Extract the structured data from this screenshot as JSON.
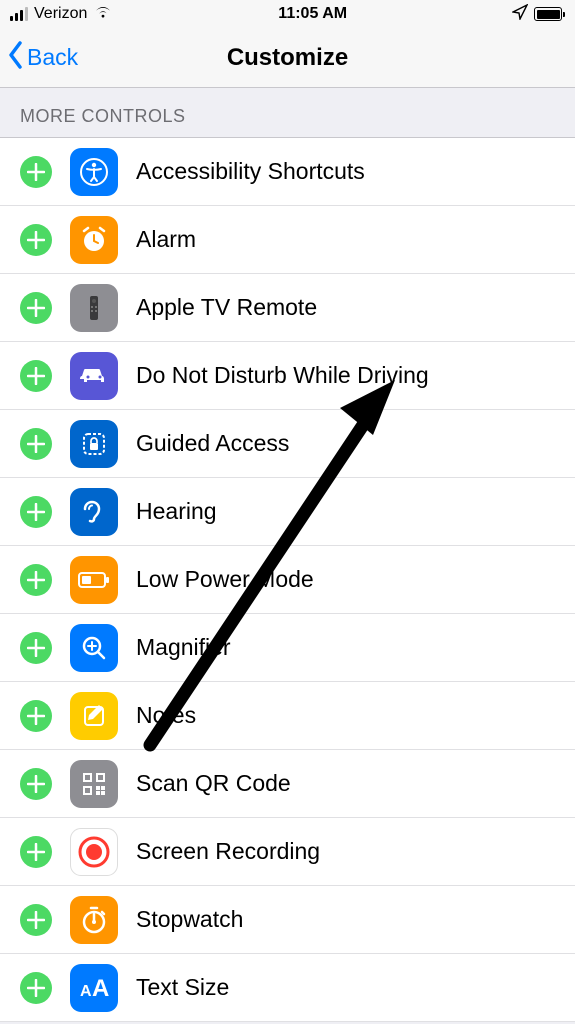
{
  "status": {
    "carrier": "Verizon",
    "time": "11:05 AM"
  },
  "nav": {
    "back_label": "Back",
    "title": "Customize"
  },
  "section": {
    "header": "MORE CONTROLS"
  },
  "controls": [
    {
      "id": "accessibility-shortcuts",
      "label": "Accessibility Shortcuts",
      "icon": "accessibility-icon",
      "color": "ic-blue"
    },
    {
      "id": "alarm",
      "label": "Alarm",
      "icon": "alarm-icon",
      "color": "ic-orange"
    },
    {
      "id": "apple-tv-remote",
      "label": "Apple TV Remote",
      "icon": "remote-icon",
      "color": "ic-gray"
    },
    {
      "id": "dnd-driving",
      "label": "Do Not Disturb While Driving",
      "icon": "car-icon",
      "color": "ic-purple"
    },
    {
      "id": "guided-access",
      "label": "Guided Access",
      "icon": "lock-dashed-icon",
      "color": "ic-darkblue"
    },
    {
      "id": "hearing",
      "label": "Hearing",
      "icon": "ear-icon",
      "color": "ic-darkblue"
    },
    {
      "id": "low-power-mode",
      "label": "Low Power Mode",
      "icon": "battery-icon",
      "color": "ic-orange"
    },
    {
      "id": "magnifier",
      "label": "Magnifier",
      "icon": "magnifier-icon",
      "color": "ic-blue"
    },
    {
      "id": "notes",
      "label": "Notes",
      "icon": "notes-icon",
      "color": "ic-yellow"
    },
    {
      "id": "scan-qr",
      "label": "Scan QR Code",
      "icon": "qr-icon",
      "color": "ic-gray"
    },
    {
      "id": "screen-recording",
      "label": "Screen Recording",
      "icon": "record-icon",
      "color": "ic-red"
    },
    {
      "id": "stopwatch",
      "label": "Stopwatch",
      "icon": "stopwatch-icon",
      "color": "ic-orange"
    },
    {
      "id": "text-size",
      "label": "Text Size",
      "icon": "text-size-icon",
      "color": "ic-blue"
    }
  ]
}
